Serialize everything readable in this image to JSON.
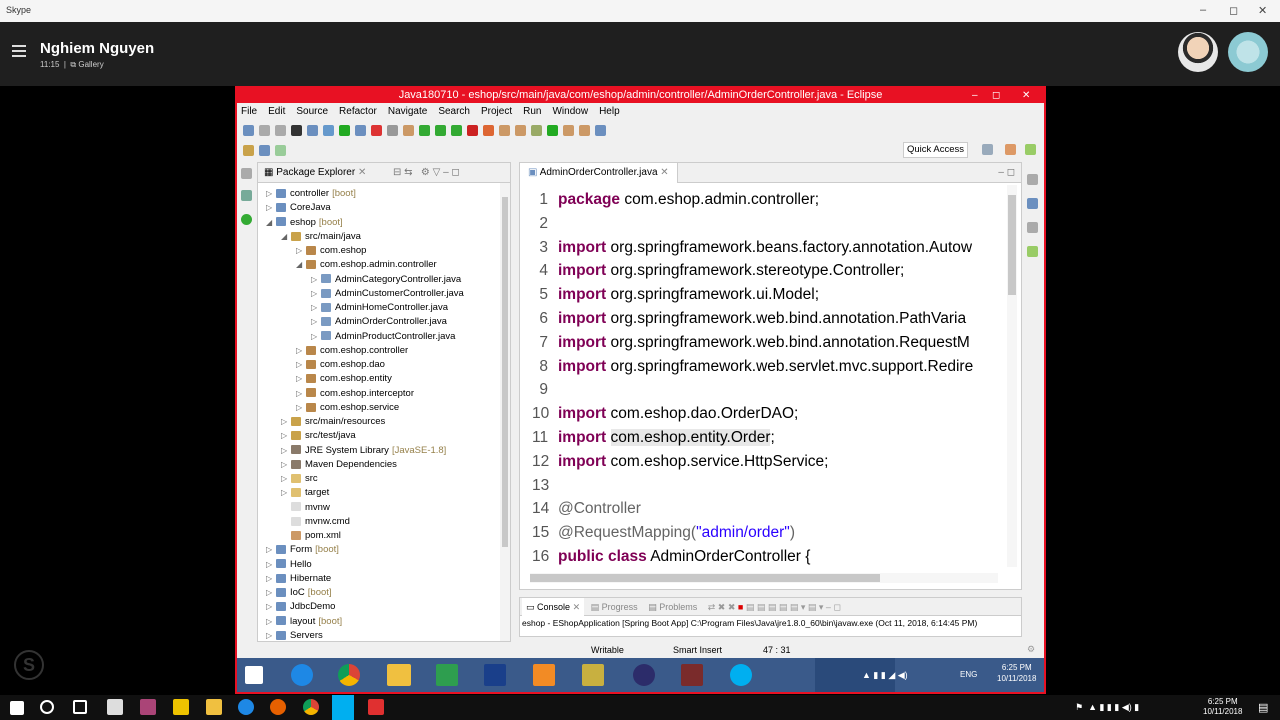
{
  "skype": {
    "title": "Skype",
    "user_name": "Nghiem Nguyen",
    "time": "11:15",
    "gallery": "Gallery",
    "min": "–",
    "max": "◻",
    "close": "✕"
  },
  "eclipse": {
    "title": "Java180710 - eshop/src/main/java/com/eshop/admin/controller/AdminOrderController.java - Eclipse",
    "menu": [
      "File",
      "Edit",
      "Source",
      "Refactor",
      "Navigate",
      "Search",
      "Project",
      "Run",
      "Window",
      "Help"
    ],
    "quick_access": "Quick Access",
    "package_explorer_tab": "Package Explorer",
    "tree": [
      {
        "arrow": "▷",
        "label": "controller",
        "tag": "[boot]",
        "indent": 0,
        "color": "#6b8fbf"
      },
      {
        "arrow": "▷",
        "label": "CoreJava",
        "tag": "",
        "indent": 0,
        "color": "#6b8fbf"
      },
      {
        "arrow": "◢",
        "label": "eshop",
        "tag": "[boot]",
        "indent": 0,
        "color": "#6b8fbf"
      },
      {
        "arrow": "◢",
        "label": "src/main/java",
        "tag": "",
        "indent": 1,
        "color": "#c9a24a"
      },
      {
        "arrow": "▷",
        "label": "com.eshop",
        "tag": "",
        "indent": 2,
        "color": "#b9874a"
      },
      {
        "arrow": "◢",
        "label": "com.eshop.admin.controller",
        "tag": "",
        "indent": 2,
        "color": "#b9874a"
      },
      {
        "arrow": "▷",
        "label": "AdminCategoryController.java",
        "tag": "",
        "indent": 3,
        "color": "#7a9ac2"
      },
      {
        "arrow": "▷",
        "label": "AdminCustomerController.java",
        "tag": "",
        "indent": 3,
        "color": "#7a9ac2"
      },
      {
        "arrow": "▷",
        "label": "AdminHomeController.java",
        "tag": "",
        "indent": 3,
        "color": "#7a9ac2"
      },
      {
        "arrow": "▷",
        "label": "AdminOrderController.java",
        "tag": "",
        "indent": 3,
        "color": "#7a9ac2"
      },
      {
        "arrow": "▷",
        "label": "AdminProductController.java",
        "tag": "",
        "indent": 3,
        "color": "#7a9ac2"
      },
      {
        "arrow": "▷",
        "label": "com.eshop.controller",
        "tag": "",
        "indent": 2,
        "color": "#b9874a"
      },
      {
        "arrow": "▷",
        "label": "com.eshop.dao",
        "tag": "",
        "indent": 2,
        "color": "#b9874a"
      },
      {
        "arrow": "▷",
        "label": "com.eshop.entity",
        "tag": "",
        "indent": 2,
        "color": "#b9874a"
      },
      {
        "arrow": "▷",
        "label": "com.eshop.interceptor",
        "tag": "",
        "indent": 2,
        "color": "#b9874a"
      },
      {
        "arrow": "▷",
        "label": "com.eshop.service",
        "tag": "",
        "indent": 2,
        "color": "#b9874a"
      },
      {
        "arrow": "▷",
        "label": "src/main/resources",
        "tag": "",
        "indent": 1,
        "color": "#c9a24a"
      },
      {
        "arrow": "▷",
        "label": "src/test/java",
        "tag": "",
        "indent": 1,
        "color": "#c9a24a"
      },
      {
        "arrow": "▷",
        "label": "JRE System Library",
        "tag": "[JavaSE-1.8]",
        "indent": 1,
        "color": "#8a7a6a"
      },
      {
        "arrow": "▷",
        "label": "Maven Dependencies",
        "tag": "",
        "indent": 1,
        "color": "#8a7a6a"
      },
      {
        "arrow": "▷",
        "label": "src",
        "tag": "",
        "indent": 1,
        "color": "#e0c070"
      },
      {
        "arrow": "▷",
        "label": "target",
        "tag": "",
        "indent": 1,
        "color": "#e0c070"
      },
      {
        "arrow": "",
        "label": "mvnw",
        "tag": "",
        "indent": 1,
        "color": "#dddddd"
      },
      {
        "arrow": "",
        "label": "mvnw.cmd",
        "tag": "",
        "indent": 1,
        "color": "#dddddd"
      },
      {
        "arrow": "",
        "label": "pom.xml",
        "tag": "",
        "indent": 1,
        "color": "#c96"
      },
      {
        "arrow": "▷",
        "label": "Form",
        "tag": "[boot]",
        "indent": 0,
        "color": "#6b8fbf"
      },
      {
        "arrow": "▷",
        "label": "Hello",
        "tag": "",
        "indent": 0,
        "color": "#6b8fbf"
      },
      {
        "arrow": "▷",
        "label": "Hibernate",
        "tag": "",
        "indent": 0,
        "color": "#6b8fbf"
      },
      {
        "arrow": "▷",
        "label": "IoC",
        "tag": "[boot]",
        "indent": 0,
        "color": "#6b8fbf"
      },
      {
        "arrow": "▷",
        "label": "JdbcDemo",
        "tag": "",
        "indent": 0,
        "color": "#6b8fbf"
      },
      {
        "arrow": "▷",
        "label": "layout",
        "tag": "[boot]",
        "indent": 0,
        "color": "#6b8fbf"
      },
      {
        "arrow": "▷",
        "label": "Servers",
        "tag": "",
        "indent": 0,
        "color": "#6b8fbf"
      }
    ],
    "editor_tab": "AdminOrderController.java",
    "code": [
      [
        "1",
        [
          [
            "kw",
            "package"
          ],
          [
            "",
            "com.eshop.admin.controller;"
          ]
        ]
      ],
      [
        "2",
        []
      ],
      [
        "3",
        [
          [
            "kw",
            "import"
          ],
          [
            "",
            "org.springframework.beans.factory.annotation.Autow"
          ]
        ]
      ],
      [
        "4",
        [
          [
            "kw",
            "import"
          ],
          [
            "",
            "org.springframework.stereotype.Controller;"
          ]
        ]
      ],
      [
        "5",
        [
          [
            "kw",
            "import"
          ],
          [
            "",
            "org.springframework.ui.Model;"
          ]
        ]
      ],
      [
        "6",
        [
          [
            "kw",
            "import"
          ],
          [
            "",
            "org.springframework.web.bind.annotation.PathVaria"
          ]
        ]
      ],
      [
        "7",
        [
          [
            "kw",
            "import"
          ],
          [
            "",
            "org.springframework.web.bind.annotation.RequestM"
          ]
        ]
      ],
      [
        "8",
        [
          [
            "kw",
            "import"
          ],
          [
            "",
            "org.springframework.web.servlet.mvc.support.Redire"
          ]
        ]
      ],
      [
        "9",
        []
      ],
      [
        "10",
        [
          [
            "kw",
            "import"
          ],
          [
            "",
            "com.eshop.dao.OrderDAO;"
          ]
        ]
      ],
      [
        "11",
        [
          [
            "kw",
            "import"
          ],
          [
            "hl",
            "com.eshop.entity.Order"
          ],
          [
            "",
            ";"
          ]
        ]
      ],
      [
        "12",
        [
          [
            "kw",
            "import"
          ],
          [
            "",
            "com.eshop.service.HttpService;"
          ]
        ]
      ],
      [
        "13",
        []
      ],
      [
        "14",
        [
          [
            "ann",
            "@Controller"
          ]
        ]
      ],
      [
        "15",
        [
          [
            "ann",
            "@RequestMapping("
          ],
          [
            "str",
            "\"admin/order\""
          ],
          [
            "ann",
            ")"
          ]
        ]
      ],
      [
        "16",
        [
          [
            "kw",
            "public class"
          ],
          [
            "",
            "AdminOrderController {"
          ]
        ]
      ]
    ],
    "console_tab": "Console",
    "progress_tab": "Progress",
    "problems_tab": "Problems",
    "console_line": "eshop - EShopApplication [Spring Boot App] C:\\Program Files\\Java\\jre1.8.0_60\\bin\\javaw.exe (Oct 11, 2018, 6:14:45 PM)",
    "status_writable": "Writable",
    "status_insert": "Smart Insert",
    "status_pos": "47 : 31",
    "vm_time": "6:25 PM",
    "vm_date": "10/11/2018",
    "vm_lang": "ENG"
  },
  "taskbar": {
    "time": "6:25 PM",
    "date": "10/11/2018"
  }
}
